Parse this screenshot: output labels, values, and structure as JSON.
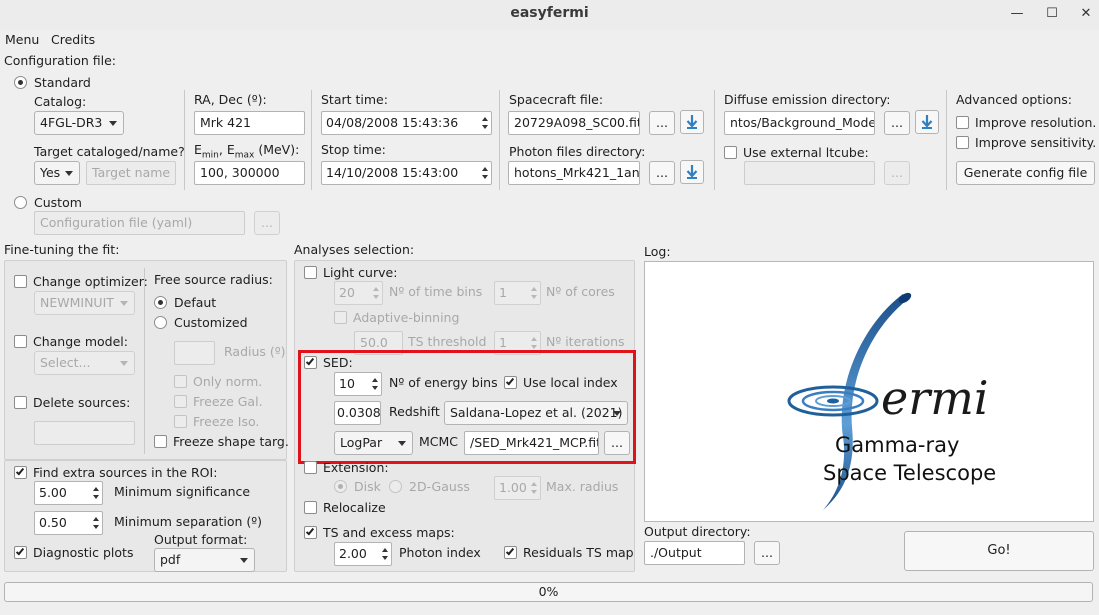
{
  "window": {
    "title": "easyfermi"
  },
  "menu": {
    "menu": "Menu",
    "credits": "Credits"
  },
  "config": {
    "label": "Configuration file:",
    "standard": "Standard",
    "catalog_label": "Catalog:",
    "catalog_value": "4FGL-DR3",
    "target_label": "Target cataloged/name?",
    "target_yesno": "Yes",
    "target_placeholder": "Target name",
    "radec_label": "RA, Dec (º):",
    "radec_value": "Mrk 421",
    "emin_label_prefix": "E",
    "emin_sub": "min",
    "emax_label_mid": ", E",
    "emax_sub": "max",
    "energy_unit": " (MeV):",
    "energy_value": "100, 300000",
    "start_label": "Start time:",
    "start_value": "04/08/2008 15:43:36",
    "stop_label": "Stop time:",
    "stop_value": "14/10/2008 15:43:00",
    "spacecraft_label": "Spacecraft file:",
    "spacecraft_value": "20729A098_SC00.fits",
    "photon_label": "Photon files directory:",
    "photon_value": "hotons_Mrk421_1ano",
    "diffuse_label": "Diffuse emission directory:",
    "diffuse_value": "ntos/Background_Models",
    "ltcube_label": "Use external ltcube:",
    "browse": "...",
    "advanced_label": "Advanced options:",
    "improve_resolution": "Improve resolution.",
    "improve_sensitivity": "Improve sensitivity.",
    "generate": "Generate config file",
    "custom": "Custom",
    "custom_placeholder": "Configuration file (yaml)"
  },
  "finetune": {
    "label": "Fine-tuning the fit:",
    "change_optimizer": "Change optimizer:",
    "optimizer_value": "NEWMINUIT",
    "change_model": "Change model:",
    "model_value": "Select...",
    "delete_sources": "Delete sources:",
    "free_radius_label": "Free source radius:",
    "default": "Defaut",
    "customized": "Customized",
    "radius_label": "Radius (º)",
    "only_norm": "Only norm.",
    "freeze_gal": "Freeze Gal.",
    "freeze_iso": "Freeze Iso.",
    "freeze_shape": "Freeze shape targ.",
    "find_extra": "Find extra sources in the ROI:",
    "min_signif_value": "5.00",
    "min_signif_label": "Minimum significance",
    "min_sep_value": "0.50",
    "min_sep_label": "Minimum separation (º)",
    "diagnostic": "Diagnostic plots",
    "output_format_label": "Output format:",
    "output_format_value": "pdf"
  },
  "analyses": {
    "label": "Analyses selection:",
    "light_curve": "Light curve:",
    "lc_bins_value": "20",
    "lc_bins_label": "Nº of time bins",
    "lc_cores_value": "1",
    "lc_cores_label": "Nº of cores",
    "adaptive": "Adaptive-binning",
    "ts_thr_value": "50.0",
    "ts_thr_label": "TS threshold",
    "iter_value": "1",
    "iter_label": "Nº iterations",
    "sed": "SED:",
    "energy_bins_value": "10",
    "energy_bins_label": "Nº of energy bins",
    "local_index": "Use local index",
    "redshift_value": "0.0308",
    "redshift_label": "Redshift",
    "ebl_value": "Saldana-Lopez et al. (2021)",
    "spectral_value": "LogPar",
    "mcmc_label": "MCMC",
    "mcmc_file": "/SED_Mrk421_MCP.fits",
    "extension": "Extension:",
    "disk": "Disk",
    "gauss": "2D-Gauss",
    "max_radius_value": "1.00",
    "max_radius_label": "Max. radius",
    "relocalize": "Relocalize",
    "ts_maps": "TS and excess maps:",
    "photon_index_value": "2.00",
    "photon_index_label": "Photon index",
    "residuals": "Residuals TS map"
  },
  "log": {
    "label": "Log:",
    "logo_word": "ermi",
    "logo_line1": "Gamma-ray",
    "logo_line2": "Space Telescope"
  },
  "output": {
    "label": "Output directory:",
    "value": "./Output",
    "go": "Go!"
  },
  "progress": {
    "value": "0%",
    "fraction": 0
  },
  "colors": {
    "highlight": "#e0131b",
    "logo_blue": "#1f5f9c"
  }
}
